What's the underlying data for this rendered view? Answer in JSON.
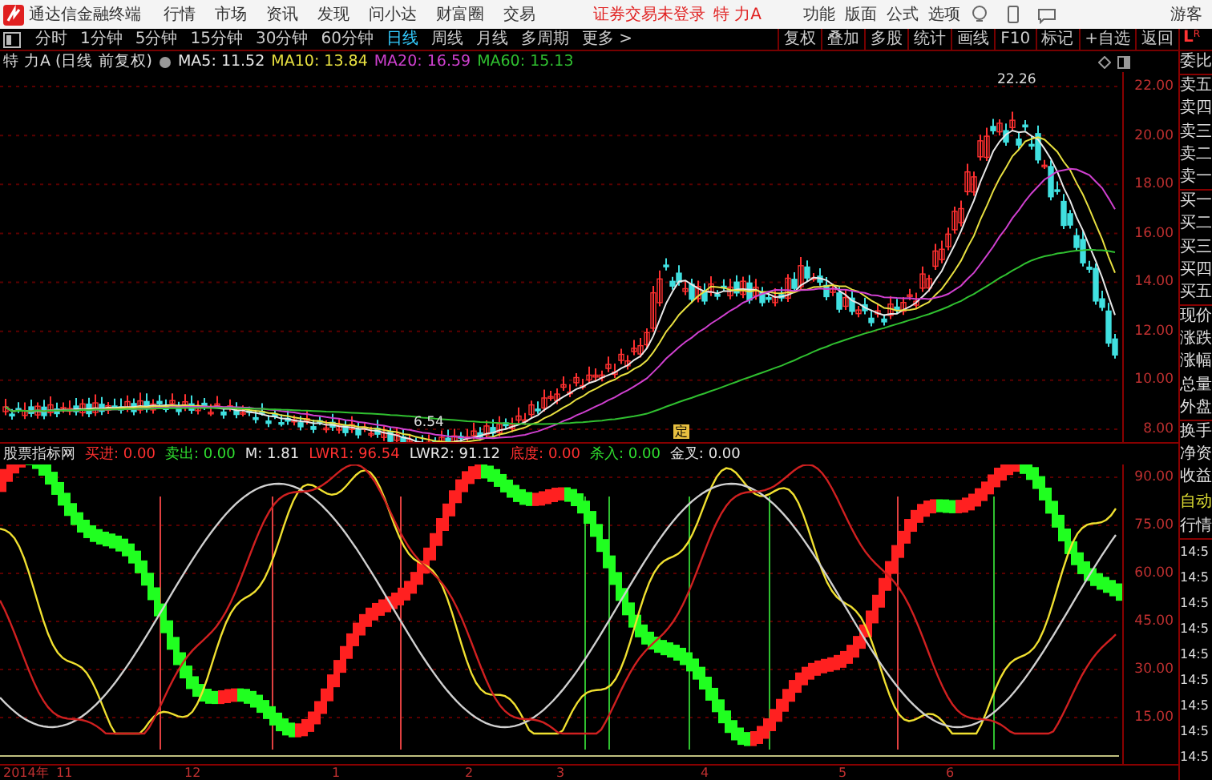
{
  "title_bar": {
    "app_name": "通达信金融终端",
    "menu": [
      "行情",
      "市场",
      "资讯",
      "发现",
      "问小达",
      "财富圈",
      "交易"
    ],
    "login_status": "证券交易未登录",
    "stock": "特 力A",
    "right_menu": [
      "功能",
      "版面",
      "公式",
      "选项"
    ],
    "user": "游客"
  },
  "toolbar": {
    "periods": [
      {
        "label": "分时",
        "selected": false
      },
      {
        "label": "1分钟",
        "selected": false
      },
      {
        "label": "5分钟",
        "selected": false
      },
      {
        "label": "15分钟",
        "selected": false
      },
      {
        "label": "30分钟",
        "selected": false
      },
      {
        "label": "60分钟",
        "selected": false
      },
      {
        "label": "日线",
        "selected": true
      },
      {
        "label": "周线",
        "selected": false
      },
      {
        "label": "月线",
        "selected": false
      },
      {
        "label": "多周期",
        "selected": false
      },
      {
        "label": "更多 >",
        "selected": false
      }
    ],
    "buttons": [
      "复权",
      "叠加",
      "多股",
      "统计",
      "画线",
      "F10",
      "标记",
      "+自选",
      "返回"
    ],
    "badge_main": "L",
    "badge_sub": "R"
  },
  "price_chart": {
    "title": "特 力A (日线 前复权)",
    "legend": [
      {
        "label": "MA5: 11.52",
        "color": "#e8e8e8"
      },
      {
        "label": "MA10: 13.84",
        "color": "#e8e040"
      },
      {
        "label": "MA20: 16.59",
        "color": "#d040d0"
      },
      {
        "label": "MA60: 15.13",
        "color": "#30c030"
      }
    ],
    "ticks": [
      "22.00",
      "20.00",
      "18.00",
      "16.00",
      "14.00",
      "12.00",
      "10.00",
      "8.00"
    ],
    "high_label": "22.26",
    "low_label": "6.54",
    "marker": "定"
  },
  "indicator": {
    "name": "股票指标网",
    "legend": [
      {
        "label": "买进: 0.00",
        "color": "#ff3030"
      },
      {
        "label": "卖出: 0.00",
        "color": "#30e030"
      },
      {
        "label": "M: 1.81",
        "color": "#e8e8e8"
      },
      {
        "label": "LWR1: 96.54",
        "color": "#ff3030"
      },
      {
        "label": "LWR2: 91.12",
        "color": "#e8e8e8"
      },
      {
        "label": "底度: 0.00",
        "color": "#ff3030"
      },
      {
        "label": "杀入: 0.00",
        "color": "#30e030"
      },
      {
        "label": "金叉: 0.00",
        "color": "#e8e8e8"
      }
    ],
    "ticks": [
      "90.00",
      "75.00",
      "60.00",
      "45.00",
      "30.00",
      "15.00"
    ]
  },
  "time_axis": [
    "2014年",
    "11",
    "12",
    "1",
    "2",
    "3",
    "4",
    "5",
    "6"
  ],
  "quote_panel": {
    "labels": [
      "委比",
      "卖五",
      "卖四",
      "卖三",
      "卖二",
      "卖一",
      "买一",
      "买二",
      "买三",
      "买四",
      "买五",
      "现价",
      "涨跌",
      "涨幅",
      "总量",
      "外盘",
      "换手",
      "净资",
      "收益"
    ],
    "auto_label": "自动",
    "feed_label": "行情",
    "times": [
      "14:5",
      "14:5",
      "14:5",
      "14:5",
      "14:5",
      "14:5",
      "14:5",
      "14:5",
      "14:5"
    ]
  }
}
